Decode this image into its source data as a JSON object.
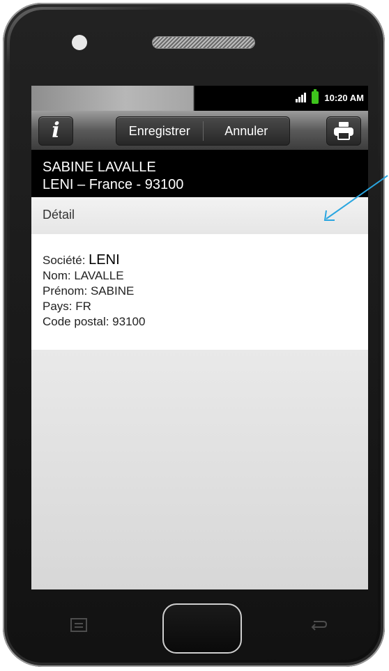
{
  "status": {
    "time": "10:20 AM"
  },
  "toolbar": {
    "info_icon": "info-icon",
    "save_label": "Enregistrer",
    "cancel_label": "Annuler",
    "print_icon": "printer-icon"
  },
  "contact_header": {
    "name": "SABINE LAVALLE",
    "location": "LENI – France - 93100"
  },
  "detail": {
    "section_title": "Détail",
    "company_label": "Société:",
    "company_value": "LENI",
    "name_line": "Nom: LAVALLE",
    "firstname_line": "Prénom: SABINE",
    "country_line": "Pays: FR",
    "postal_line": "Code postal: 93100"
  },
  "colors": {
    "arrow": "#2aa6e0",
    "battery": "#3ec41c"
  },
  "icons": [
    "camera-icon",
    "speaker-grille-icon",
    "signal-icon",
    "battery-icon",
    "info-icon",
    "printer-icon",
    "menu-icon",
    "back-icon"
  ]
}
